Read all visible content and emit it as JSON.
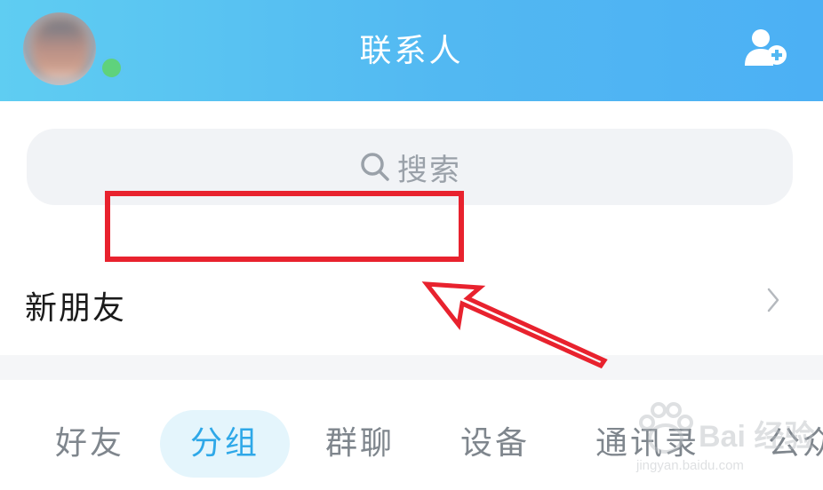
{
  "header": {
    "title": "联系人",
    "avatar_icon": "user-avatar",
    "status": "online",
    "status_color": "#5fd27c",
    "add_icon": "add-contact-icon",
    "gradient": [
      "#5fcdf2",
      "#4cb0f4"
    ]
  },
  "search": {
    "placeholder": "搜索",
    "icon": "search-icon"
  },
  "list": {
    "new_friends_label": "新朋友",
    "chevron_icon": "chevron-right-icon"
  },
  "tabs": {
    "items": [
      {
        "label": "好友",
        "active": false
      },
      {
        "label": "分组",
        "active": true
      },
      {
        "label": "群聊",
        "active": false
      },
      {
        "label": "设备",
        "active": false
      },
      {
        "label": "通讯录",
        "active": false
      },
      {
        "label": "公众",
        "active": false
      }
    ],
    "active_color": "#2ea8e8",
    "inactive_color": "#7f868d"
  },
  "annotation": {
    "color": "#e8222e"
  },
  "watermark": {
    "brand": "Bai 经验",
    "url": "jingyan.baidu.com"
  }
}
